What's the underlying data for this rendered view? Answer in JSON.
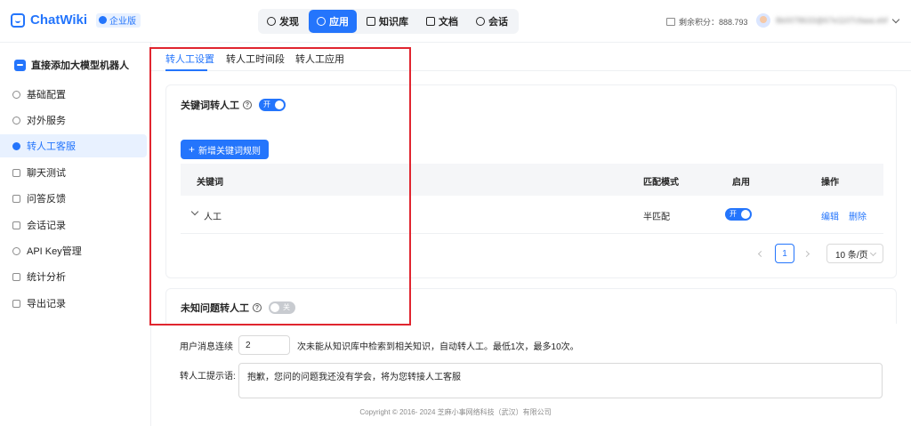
{
  "app": {
    "name": "ChatWiki",
    "badge": "企业版"
  },
  "nav": [
    {
      "label": "发现",
      "icon": "discover-icon",
      "active": false
    },
    {
      "label": "应用",
      "icon": "app-icon",
      "active": true
    },
    {
      "label": "知识库",
      "icon": "knowledge-base-icon",
      "active": false
    },
    {
      "label": "文档",
      "icon": "document-icon",
      "active": false
    },
    {
      "label": "会话",
      "icon": "chat-icon",
      "active": false
    }
  ],
  "header": {
    "points": "剩余积分：888.793",
    "user": "8b0078633@67e1107cfaaa.ebf"
  },
  "sidebar": {
    "robot_name": "直接添加大模型机器人",
    "items": [
      {
        "label": "基础配置",
        "icon": "gear-icon"
      },
      {
        "label": "对外服务",
        "icon": "service-icon"
      },
      {
        "label": "转人工客服",
        "icon": "agent-icon"
      },
      {
        "label": "聊天测试",
        "icon": "chat-test-icon"
      },
      {
        "label": "问答反馈",
        "icon": "feedback-icon"
      },
      {
        "label": "会话记录",
        "icon": "record-icon"
      },
      {
        "label": "API Key管理",
        "icon": "key-icon"
      },
      {
        "label": "统计分析",
        "icon": "stats-icon"
      },
      {
        "label": "导出记录",
        "icon": "export-icon"
      }
    ],
    "active_index": 2
  },
  "tabs": [
    {
      "label": "转人工设置",
      "active": true
    },
    {
      "label": "转人工时间段",
      "active": false
    },
    {
      "label": "转人工应用",
      "active": false
    }
  ],
  "keyword_card": {
    "title": "关键词转人工",
    "help": "?",
    "switch_label": "开",
    "add_button": "新增关键词规则",
    "columns": {
      "keyword": "关键词",
      "match": "匹配模式",
      "enable": "启用",
      "action": "操作"
    },
    "rows": [
      {
        "keyword": "人工",
        "match": "半匹配",
        "enabled_label": "开",
        "edit": "编辑",
        "delete": "删除"
      }
    ],
    "pagination": {
      "current": "1",
      "page_size": "10 条/页"
    }
  },
  "unknown_card": {
    "title": "未知问题转人工",
    "help": "?",
    "switch_label": "关",
    "count_prefix": "用户消息连续",
    "count_value": "2",
    "count_suffix": "次未能从知识库中检索到相关知识，自动转人工。最低1次，最多10次。",
    "prompt_label": "转人工提示语:",
    "prompt_value": "抱歉，您问的问题我还没有学会，将为您转接人工客服"
  },
  "footer": "Copyright © 2016- 2024 芝麻小事网络科技（武汉）有限公司",
  "colors": {
    "accent": "#2475fc",
    "highlight": "#e0252f"
  }
}
